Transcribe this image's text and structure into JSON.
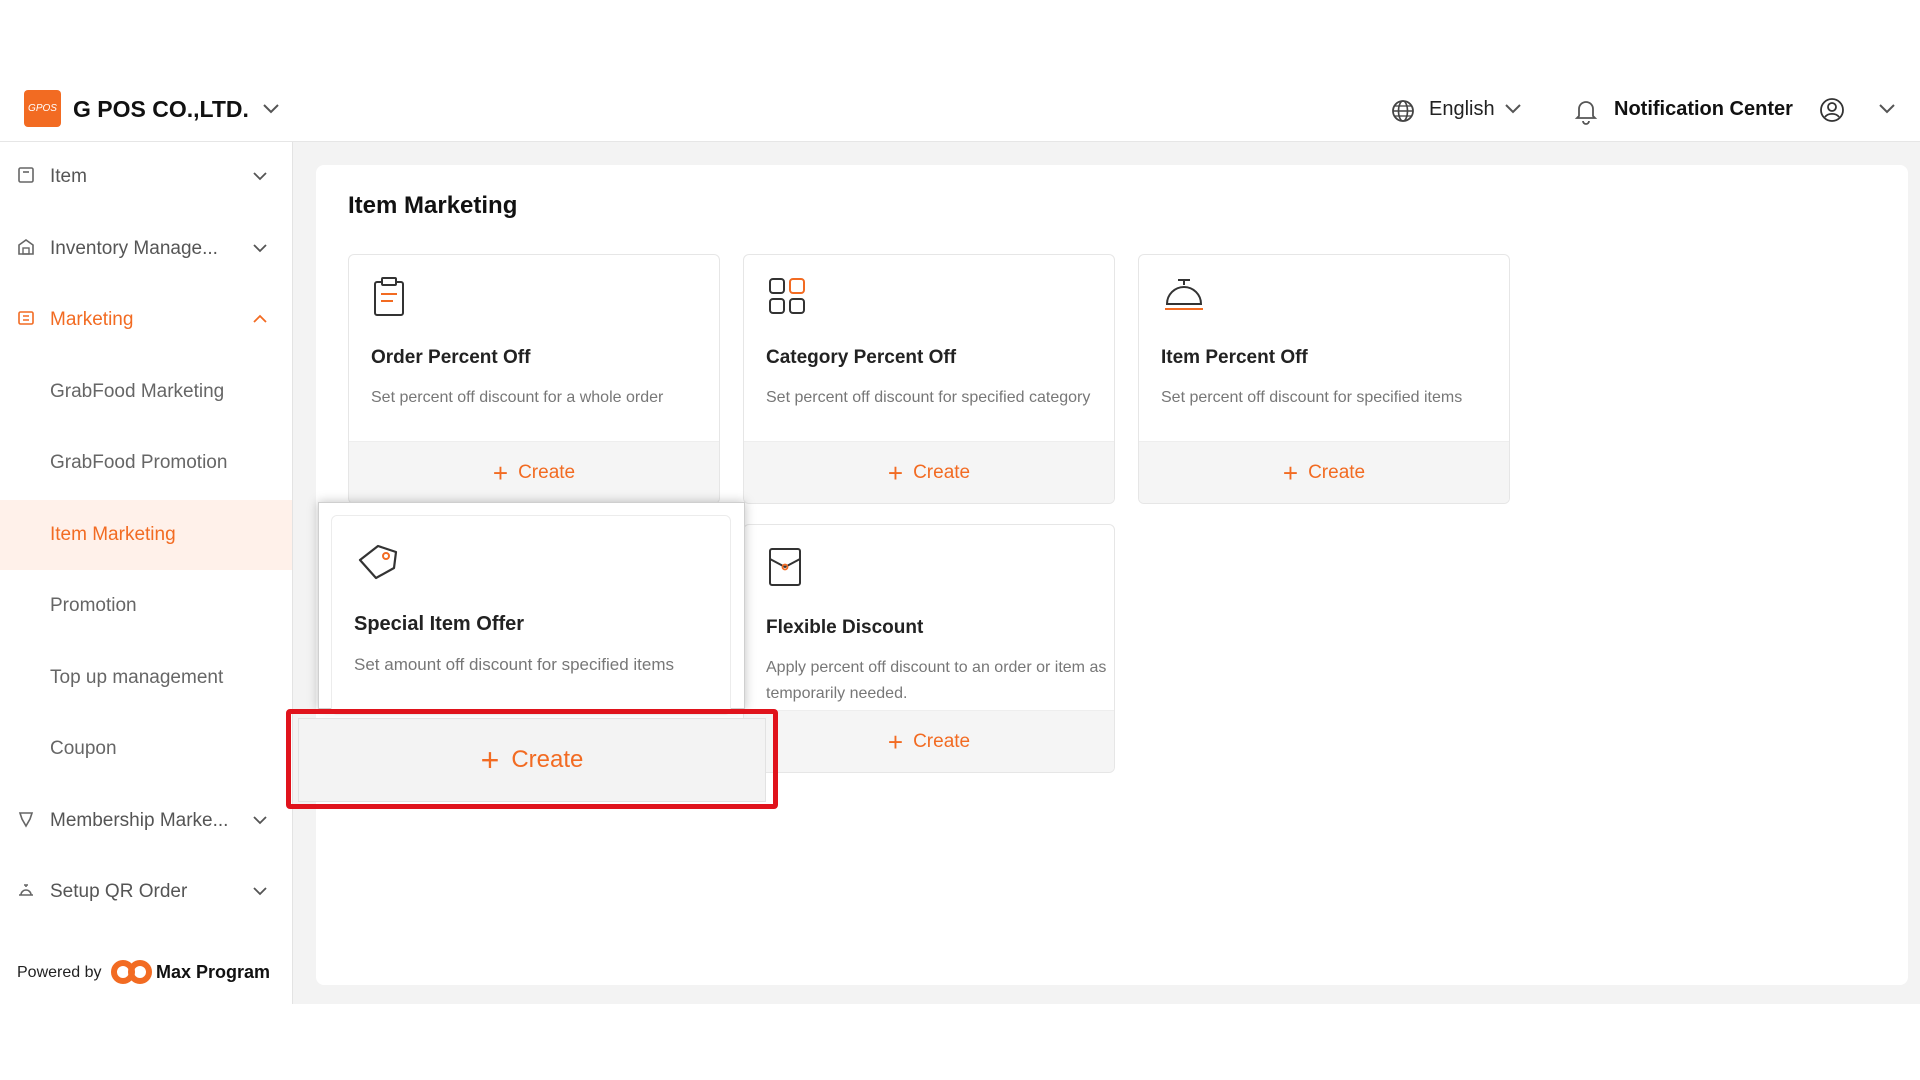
{
  "header": {
    "logo_text": "GPOS",
    "company_name": "G POS CO.,LTD.",
    "language": "English",
    "notification_label": "Notification Center"
  },
  "sidebar": {
    "items": [
      {
        "label": "Item",
        "icon": "item-icon"
      },
      {
        "label": "Inventory Manage...",
        "icon": "inventory-icon"
      },
      {
        "label": "Marketing",
        "icon": "marketing-icon"
      },
      {
        "label": "GrabFood Marketing"
      },
      {
        "label": "GrabFood Promotion"
      },
      {
        "label": "Item Marketing"
      },
      {
        "label": "Promotion"
      },
      {
        "label": "Top up management"
      },
      {
        "label": "Coupon"
      },
      {
        "label": "Membership Marke...",
        "icon": "membership-icon"
      },
      {
        "label": "Setup QR Order",
        "icon": "qr-order-icon"
      }
    ],
    "footer": {
      "powered_by": "Powered by",
      "brand": "Max Program"
    }
  },
  "main": {
    "title": "Item Marketing",
    "cards": [
      {
        "title": "Order Percent Off",
        "description": "Set percent off discount for a whole order",
        "action": "Create"
      },
      {
        "title": "Category Percent Off",
        "description": "Set percent off discount for specified category",
        "action": "Create"
      },
      {
        "title": "Item Percent Off",
        "description": "Set percent off discount for specified items",
        "action": "Create"
      },
      {
        "title": "Special Item Offer",
        "description": "Set amount off discount for specified items",
        "action": "Create"
      },
      {
        "title": "Flexible Discount",
        "description": "Apply percent off discount to an order or item as temporarily needed.",
        "action": "Create"
      }
    ]
  },
  "colors": {
    "accent": "#f26b22",
    "highlight": "#e0131c",
    "active_bg": "#fff1ea"
  }
}
